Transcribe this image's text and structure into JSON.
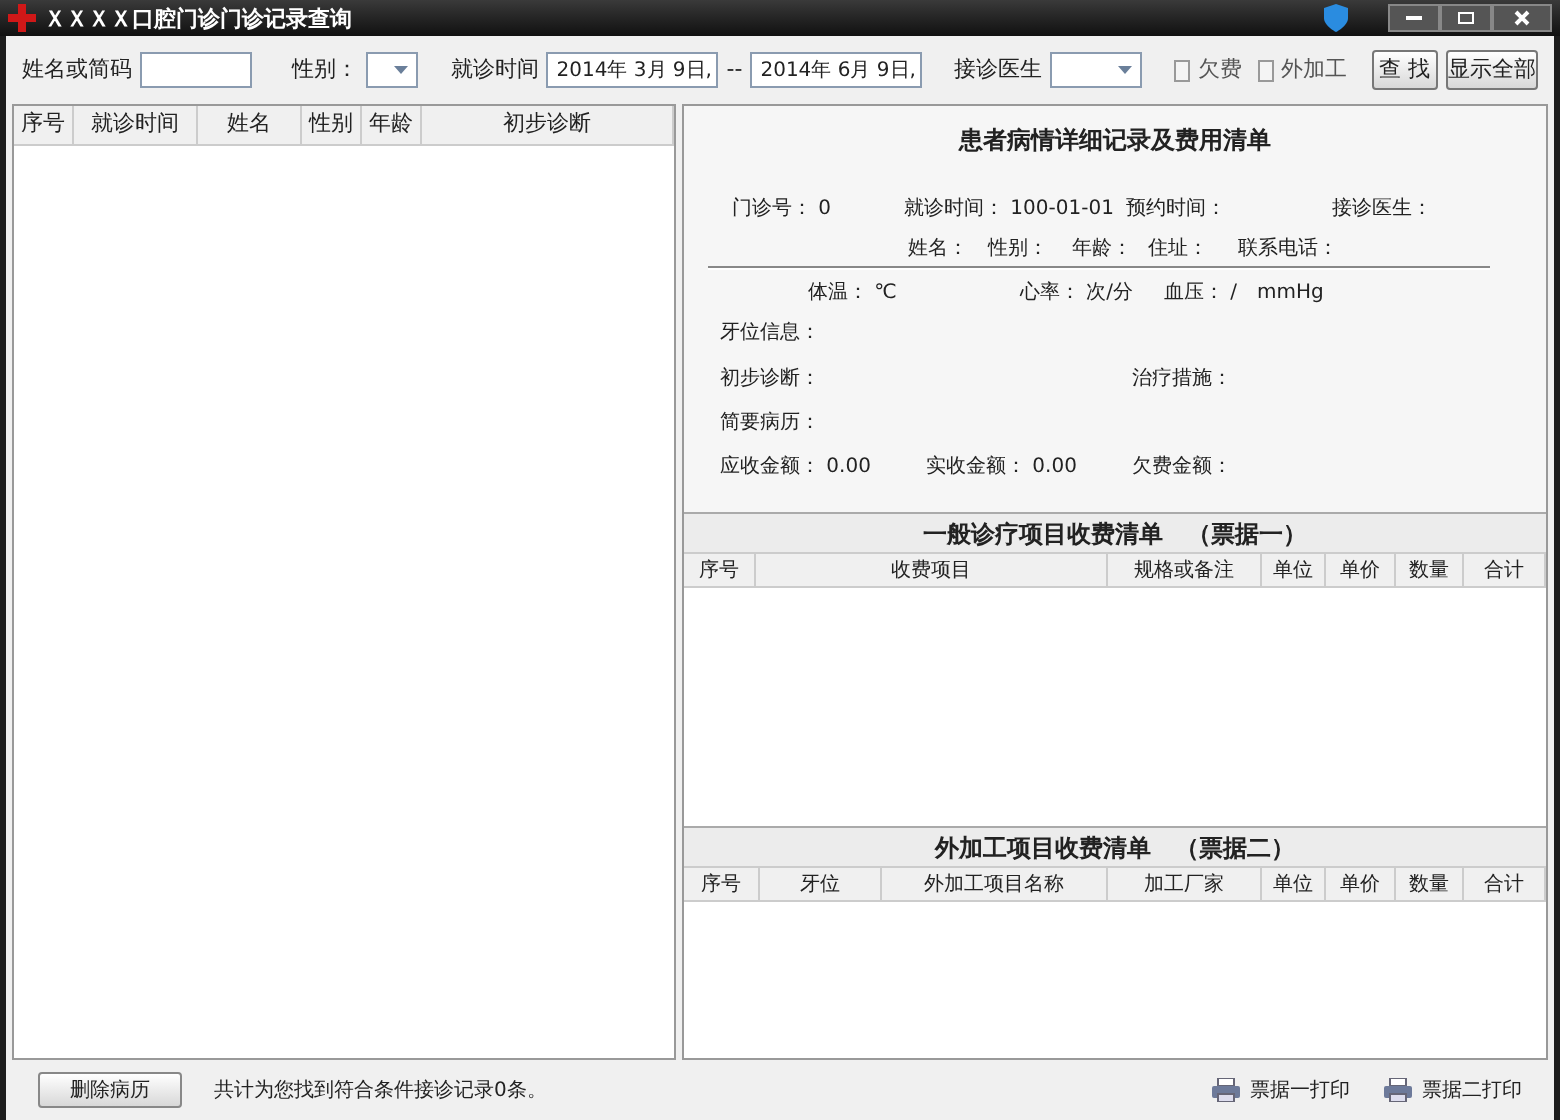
{
  "window": {
    "title": "ＸＸＸＸ口腔门诊门诊记录查询"
  },
  "search": {
    "name_label": "姓名或简码",
    "gender_label": "性别：",
    "date_label": "就诊时间",
    "date_from": "2014年 3月 9日,",
    "date_sep": "--",
    "date_to": "2014年 6月 9日,",
    "doctor_label": "接诊医生",
    "checkboxes": [
      {
        "label": "欠费",
        "checked": false
      },
      {
        "label": "外加工",
        "checked": false
      }
    ],
    "buttons": [
      "查 找",
      "显示全部"
    ]
  },
  "records_table": {
    "columns": [
      "序号",
      "就诊时间",
      "姓名",
      "性别",
      "年龄",
      "初步诊断"
    ]
  },
  "detail": {
    "title": "患者病情详细记录及费用清单",
    "fields": [
      {
        "label": "门诊号：",
        "value": "0"
      },
      {
        "label": "就诊时间：",
        "value": "100-01-01"
      },
      {
        "label": "预约时间："
      },
      {
        "label": "接诊医生："
      },
      {
        "label": "姓名："
      },
      {
        "label": "性别："
      },
      {
        "label": "年龄："
      },
      {
        "label": "住址："
      },
      {
        "label": "联系电话："
      },
      {
        "label": "体温：",
        "value": "℃"
      },
      {
        "label": "心率：",
        "value": "次/分"
      },
      {
        "label": "血压：",
        "value": "/　mmHg"
      },
      {
        "label": "牙位信息："
      },
      {
        "label": "初步诊断："
      },
      {
        "label": "治疗措施："
      },
      {
        "label": "简要病历："
      },
      {
        "label": "应收金额：",
        "value": "0.00"
      },
      {
        "label": "实收金额：",
        "value": "0.00"
      },
      {
        "label": "欠费金额："
      }
    ]
  },
  "fee_table_1": {
    "title": "一般诊疗项目收费清单　（票据一）",
    "columns": [
      "序号",
      "收费项目",
      "规格或备注",
      "单位",
      "单价",
      "数量",
      "合计"
    ]
  },
  "fee_table_2": {
    "title": "外加工项目收费清单　（票据二）",
    "columns": [
      "序号",
      "牙位",
      "外加工项目名称",
      "加工厂家",
      "单位",
      "单价",
      "数量",
      "合计"
    ]
  },
  "footer": {
    "delete_button": "删除病历",
    "status": "共计为您找到符合条件接诊记录0条。",
    "print_buttons": [
      "票据一打印",
      "票据二打印"
    ]
  }
}
